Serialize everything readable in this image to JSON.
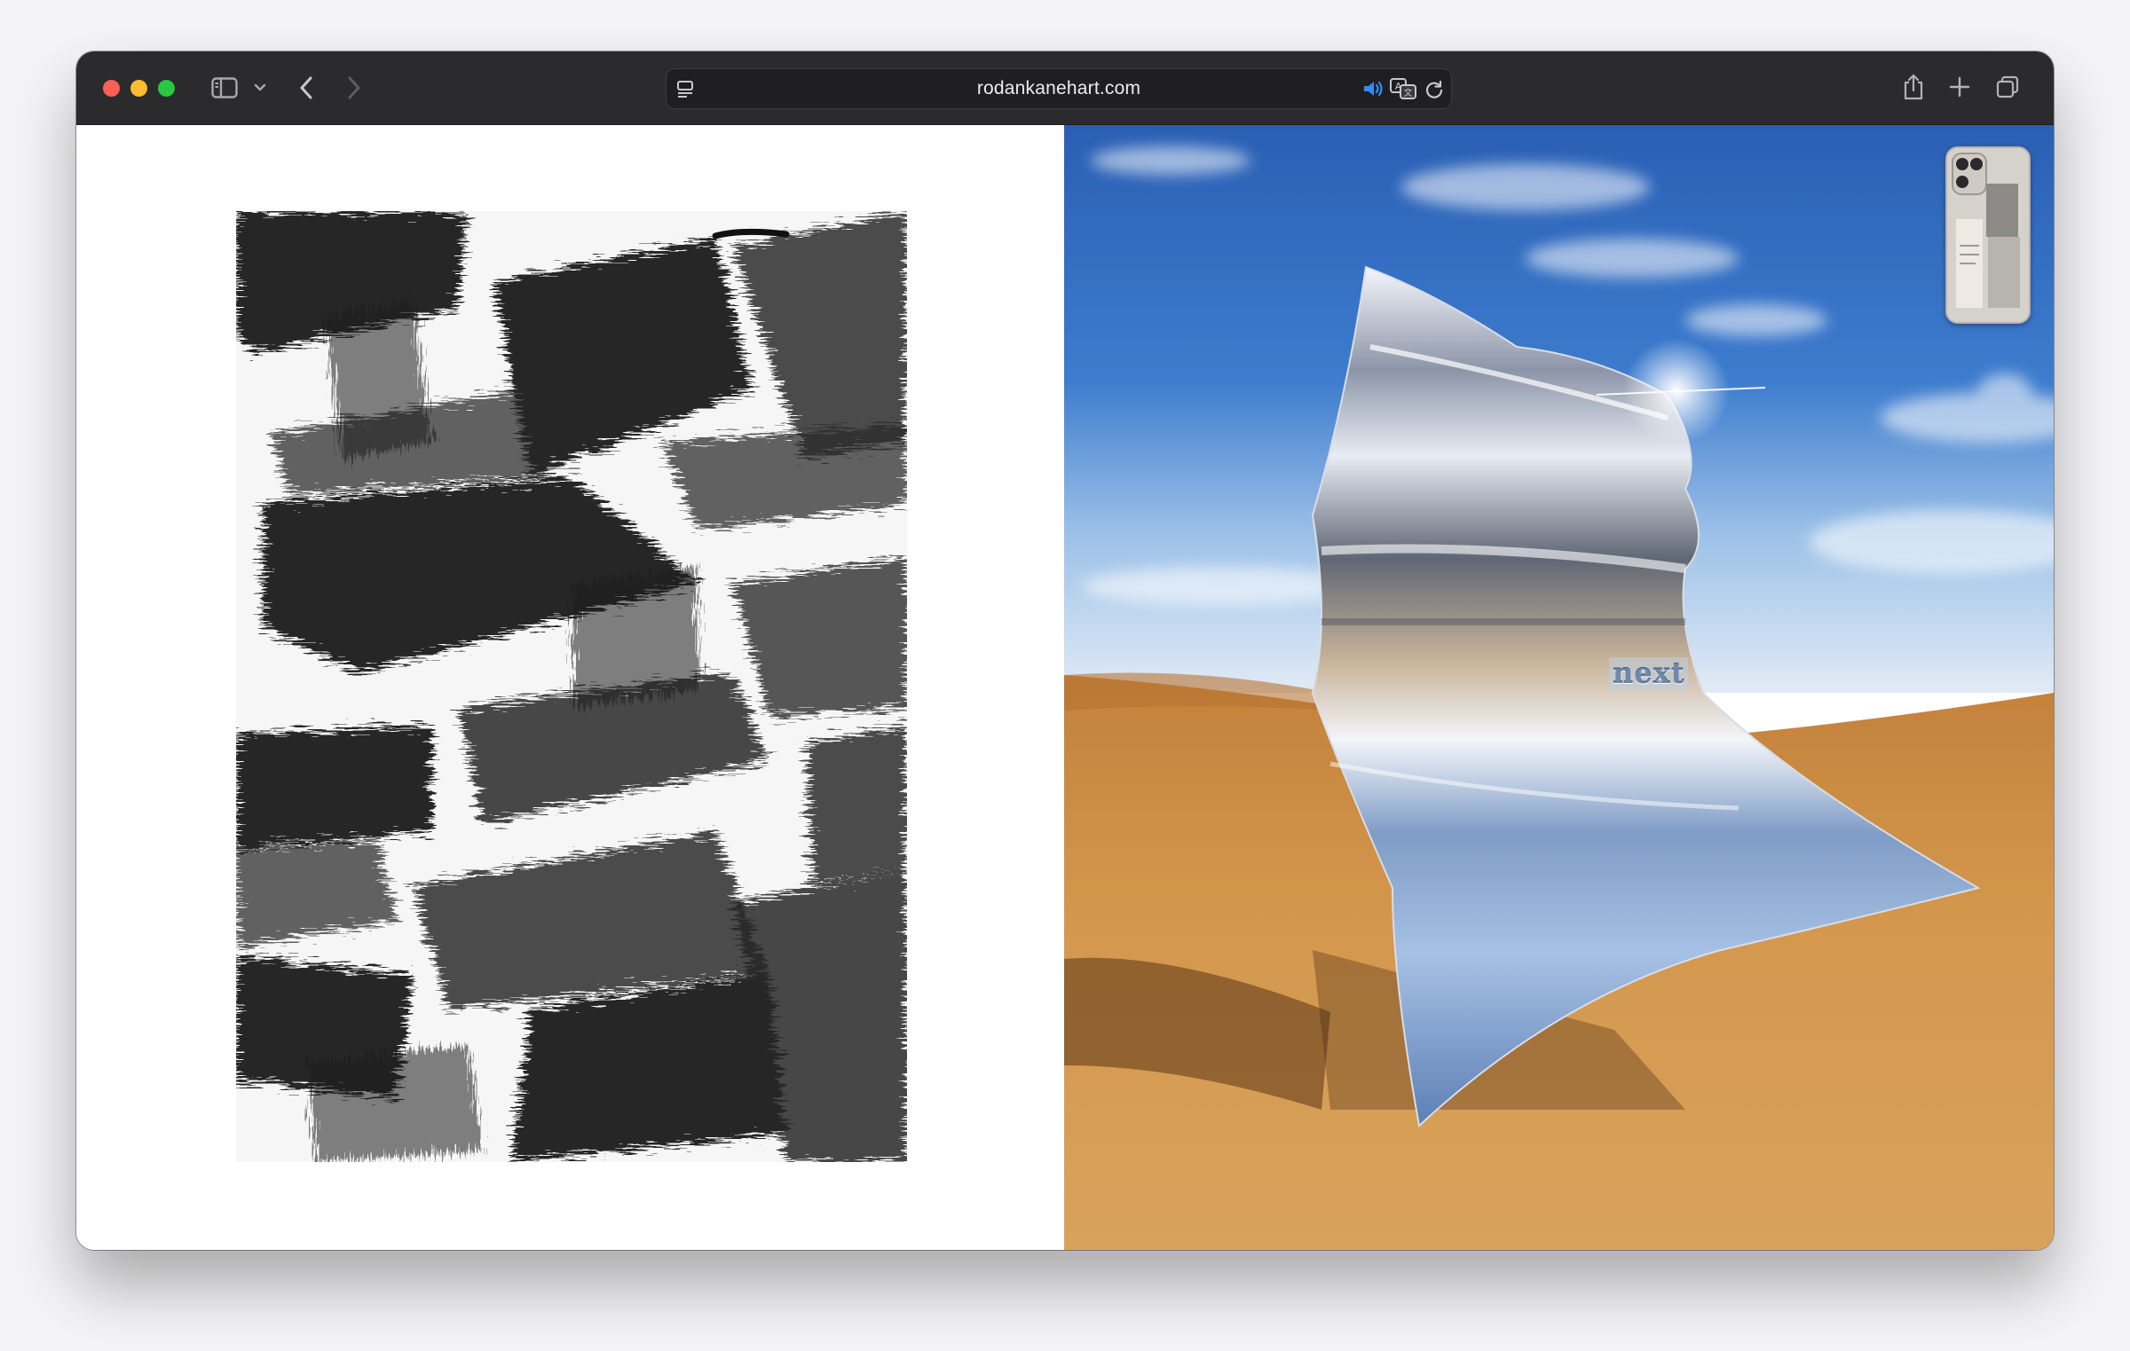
{
  "browser": {
    "url": "rodankanehart.com",
    "icons": {
      "sidebar": "sidebar-toggle-icon",
      "sidebar_menu": "chevron-down-icon",
      "back": "back-arrow-icon",
      "forward": "forward-arrow-icon",
      "reader": "page-menu-icon",
      "audio": "speaker-icon",
      "translate": "translate-icon",
      "reload": "reload-icon",
      "share": "share-icon",
      "new_tab": "plus-icon",
      "tabs": "tab-overview-icon"
    },
    "colors": {
      "close": "#fe5f57",
      "minimize": "#febc2e",
      "maximize": "#28c840",
      "audio_accent": "#2f8cff"
    }
  },
  "page": {
    "left_artwork": "black ink brushstroke artwork",
    "right_photo": "mirror sculpture in desert",
    "phone_thumbnail": "phone thumbnail",
    "next_label": "next"
  }
}
